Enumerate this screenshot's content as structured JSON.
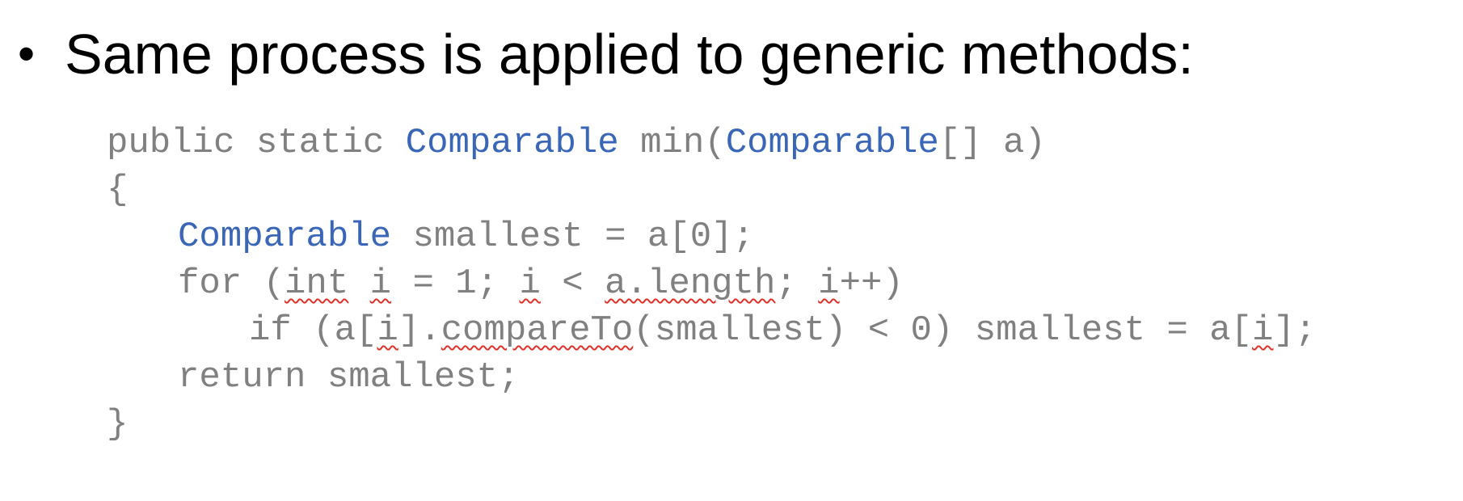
{
  "slide": {
    "bullet_symbol": "•",
    "bullet_text": "Same process is applied to generic methods:"
  },
  "colors": {
    "bullet_text": "#000000",
    "code_plain": "#808080",
    "code_type": "#3a66b8",
    "spellcheck_underline": "#e0322a"
  },
  "code": {
    "lines": [
      {
        "indent": 0,
        "tokens": [
          {
            "text": "public static ",
            "style": "plain"
          },
          {
            "text": "Comparable",
            "style": "type"
          },
          {
            "text": " min(",
            "style": "plain"
          },
          {
            "text": "Comparable",
            "style": "type"
          },
          {
            "text": "[] a)",
            "style": "plain"
          }
        ]
      },
      {
        "indent": 0,
        "tokens": [
          {
            "text": "{",
            "style": "plain"
          }
        ]
      },
      {
        "indent": 1,
        "tokens": [
          {
            "text": "Comparable",
            "style": "type"
          },
          {
            "text": " smallest = a[0];",
            "style": "plain"
          }
        ]
      },
      {
        "indent": 1,
        "tokens": [
          {
            "text": "for (",
            "style": "plain"
          },
          {
            "text": "int",
            "style": "spell"
          },
          {
            "text": " ",
            "style": "plain"
          },
          {
            "text": "i",
            "style": "spell"
          },
          {
            "text": " = 1; ",
            "style": "plain"
          },
          {
            "text": "i",
            "style": "spell"
          },
          {
            "text": " < ",
            "style": "plain"
          },
          {
            "text": "a.length",
            "style": "spell"
          },
          {
            "text": "; ",
            "style": "plain"
          },
          {
            "text": "i",
            "style": "spell"
          },
          {
            "text": "++)",
            "style": "plain"
          }
        ]
      },
      {
        "indent": 2,
        "tokens": [
          {
            "text": "if (a[",
            "style": "plain"
          },
          {
            "text": "i",
            "style": "spell"
          },
          {
            "text": "].",
            "style": "plain"
          },
          {
            "text": "compareTo",
            "style": "spell"
          },
          {
            "text": "(smallest) < 0) smallest = a[",
            "style": "plain"
          },
          {
            "text": "i",
            "style": "spell"
          },
          {
            "text": "];",
            "style": "plain"
          }
        ]
      },
      {
        "indent": 1,
        "tokens": [
          {
            "text": "return smallest;",
            "style": "plain"
          }
        ]
      },
      {
        "indent": 0,
        "tokens": [
          {
            "text": "}",
            "style": "plain"
          }
        ]
      }
    ]
  }
}
